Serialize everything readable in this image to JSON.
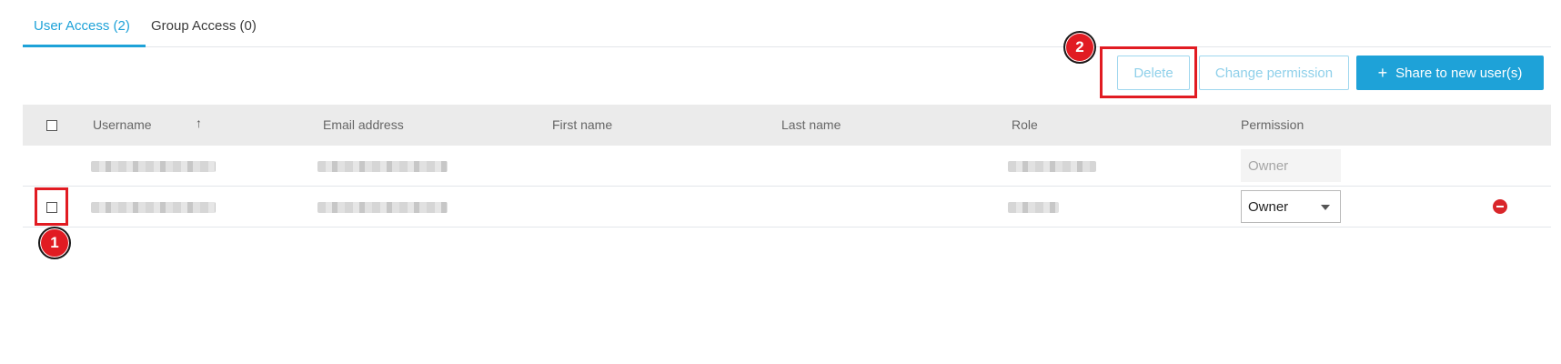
{
  "tabs": [
    {
      "label": "User Access (2)",
      "active": true
    },
    {
      "label": "Group Access (0)",
      "active": false
    }
  ],
  "toolbar": {
    "delete_label": "Delete",
    "change_permission_label": "Change permission",
    "share_label": "Share to new user(s)",
    "share_icon": "+"
  },
  "table": {
    "columns": [
      "Username",
      "Email address",
      "First name",
      "Last name",
      "Role",
      "Permission"
    ],
    "sort_icon": "↑",
    "rows": [
      {
        "permission": "Owner",
        "editable": false
      },
      {
        "permission": "Owner",
        "editable": true
      }
    ]
  },
  "annotations": {
    "marker_1": "1",
    "marker_2": "2"
  },
  "colors": {
    "accent": "#1ea2d8",
    "highlight": "#e11b22",
    "remove": "#d9262a"
  }
}
